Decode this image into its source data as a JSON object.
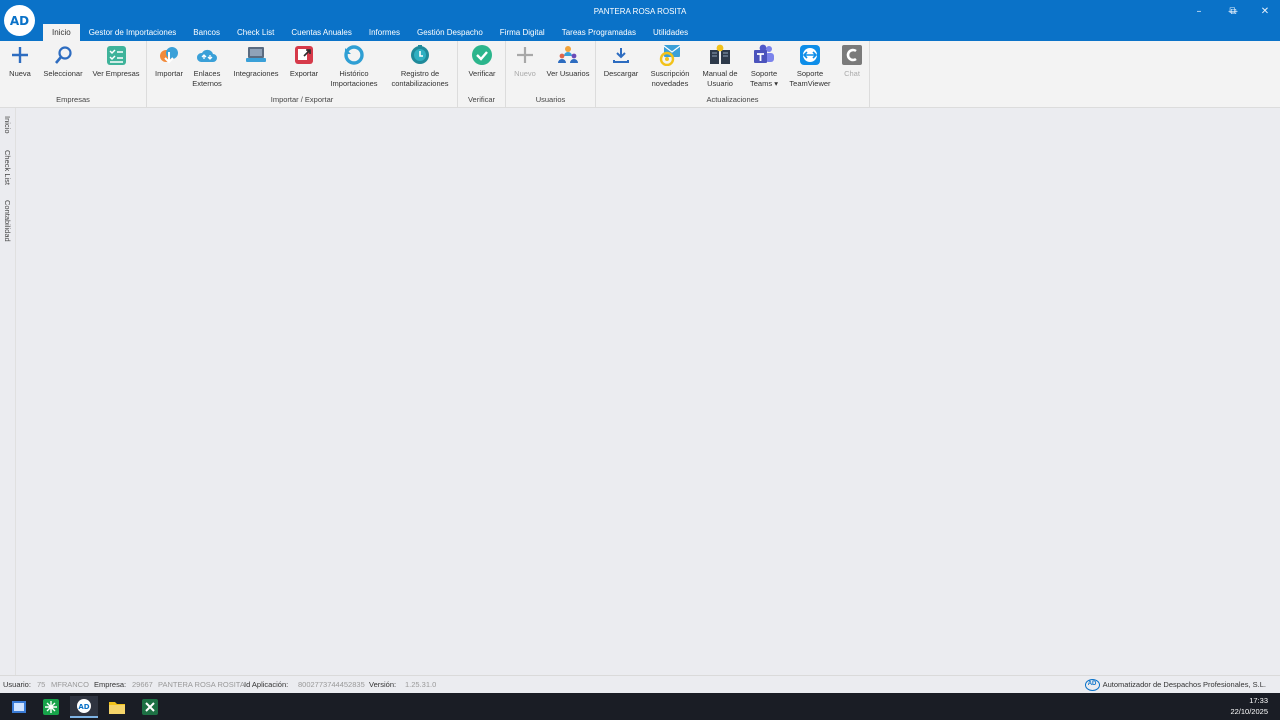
{
  "window": {
    "title": "PANTERA ROSA ROSITA",
    "logo_text": "AD",
    "controls": [
      "minimize-icon",
      "restore-icon",
      "close-icon"
    ]
  },
  "tabs": [
    "Inicio",
    "Gestor de Importaciones",
    "Bancos",
    "Check List",
    "Cuentas Anuales",
    "Informes",
    "Gestión Despacho",
    "Firma Digital",
    "Tareas Programadas",
    "Utilidades"
  ],
  "ribbon": {
    "empresas": {
      "label": "Empresas",
      "nueva": "Nueva",
      "seleccionar": "Seleccionar",
      "ver_empresas": "Ver Empresas"
    },
    "importar_exportar": {
      "label": "Importar / Exportar",
      "importar": "Importar",
      "enlaces_1": "Enlaces",
      "enlaces_2": "Externos",
      "integraciones": "Integraciones",
      "exportar": "Exportar",
      "historico_1": "Histórico",
      "historico_2": "Importaciones",
      "registro_1": "Registro de",
      "registro_2": "contabilizaciones"
    },
    "verificar": {
      "label": "Verificar",
      "verificar": "Verificar"
    },
    "usuarios": {
      "label": "Usuarios",
      "nuevo": "Nuevo",
      "ver_usuarios": "Ver Usuarios"
    },
    "actualizaciones": {
      "label": "Actualizaciones",
      "descargar": "Descargar",
      "suscripcion_1": "Suscripción",
      "suscripcion_2": "novedades",
      "manual_1": "Manual de",
      "manual_2": "Usuario",
      "soporte_teams_1": "Soporte",
      "soporte_teams_2": "Teams ▾",
      "soporte_tv_1": "Soporte",
      "soporte_tv_2": "TeamViewer",
      "chat": "Chat"
    }
  },
  "sidebar": [
    "Inicio",
    "Check List",
    "Contabilidad"
  ],
  "status": {
    "usuario_label": "Usuario:",
    "usuario_id": "75",
    "usuario_name": "MFRANCO",
    "empresa_label": "Empresa:",
    "empresa_id": "29667",
    "empresa_name": "PANTERA ROSA ROSITA",
    "idapp_label": "Id Aplicación:",
    "idapp_value": "8002773744452835",
    "version_label": "Versión:",
    "version_value": "1.25.31.0",
    "brand": "Automatizador de Despachos Profesionales, S.L."
  },
  "taskbar": {
    "icons": [
      "windows-icon",
      "green-app-icon",
      "ad-app-icon",
      "file-explorer-icon",
      "excel-icon"
    ],
    "time": "17:33",
    "date": "22/10/2025"
  },
  "colors": {
    "titlebar": "#0a72c8",
    "ribbon": "#f3f3f3",
    "workspace": "#ebecf0",
    "taskbar": "#1a1d25"
  }
}
